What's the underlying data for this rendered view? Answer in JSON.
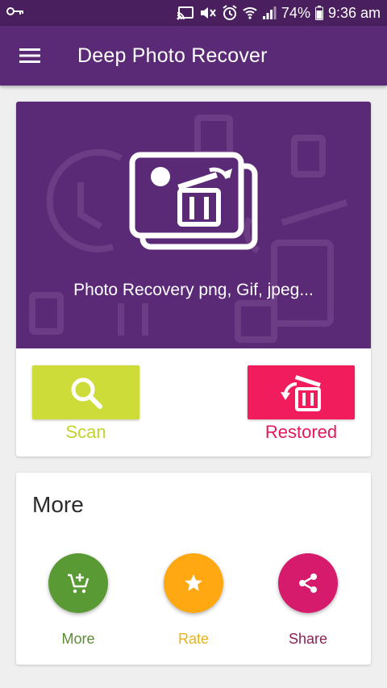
{
  "status_bar": {
    "battery": "74%",
    "time": "9:36 am",
    "icons": [
      "key-icon",
      "cast-icon",
      "mute-icon",
      "alarm-icon",
      "wifi-icon",
      "signal-icon",
      "battery-icon"
    ]
  },
  "app_bar": {
    "title": "Deep Photo Recover",
    "menu_icon": "hamburger-menu-icon"
  },
  "hero": {
    "icon": "photo-trash-icon",
    "text": "Photo Recovery png, Gif, jpeg..."
  },
  "actions": {
    "scan": {
      "label": "Scan",
      "icon": "search-icon"
    },
    "restored": {
      "label": "Restored",
      "icon": "restore-trash-icon"
    }
  },
  "more_section": {
    "title": "More",
    "items": [
      {
        "label": "More",
        "icon": "add-to-cart-icon"
      },
      {
        "label": "Rate",
        "icon": "star-icon"
      },
      {
        "label": "Share",
        "icon": "share-icon"
      }
    ]
  },
  "colors": {
    "primary": "#5b2a76",
    "status_bar": "#4a1f5e",
    "scan": "#cddc39",
    "restored": "#f11c5c",
    "more": "#5a9a34",
    "rate": "#ffa812",
    "share": "#d61a6c"
  }
}
